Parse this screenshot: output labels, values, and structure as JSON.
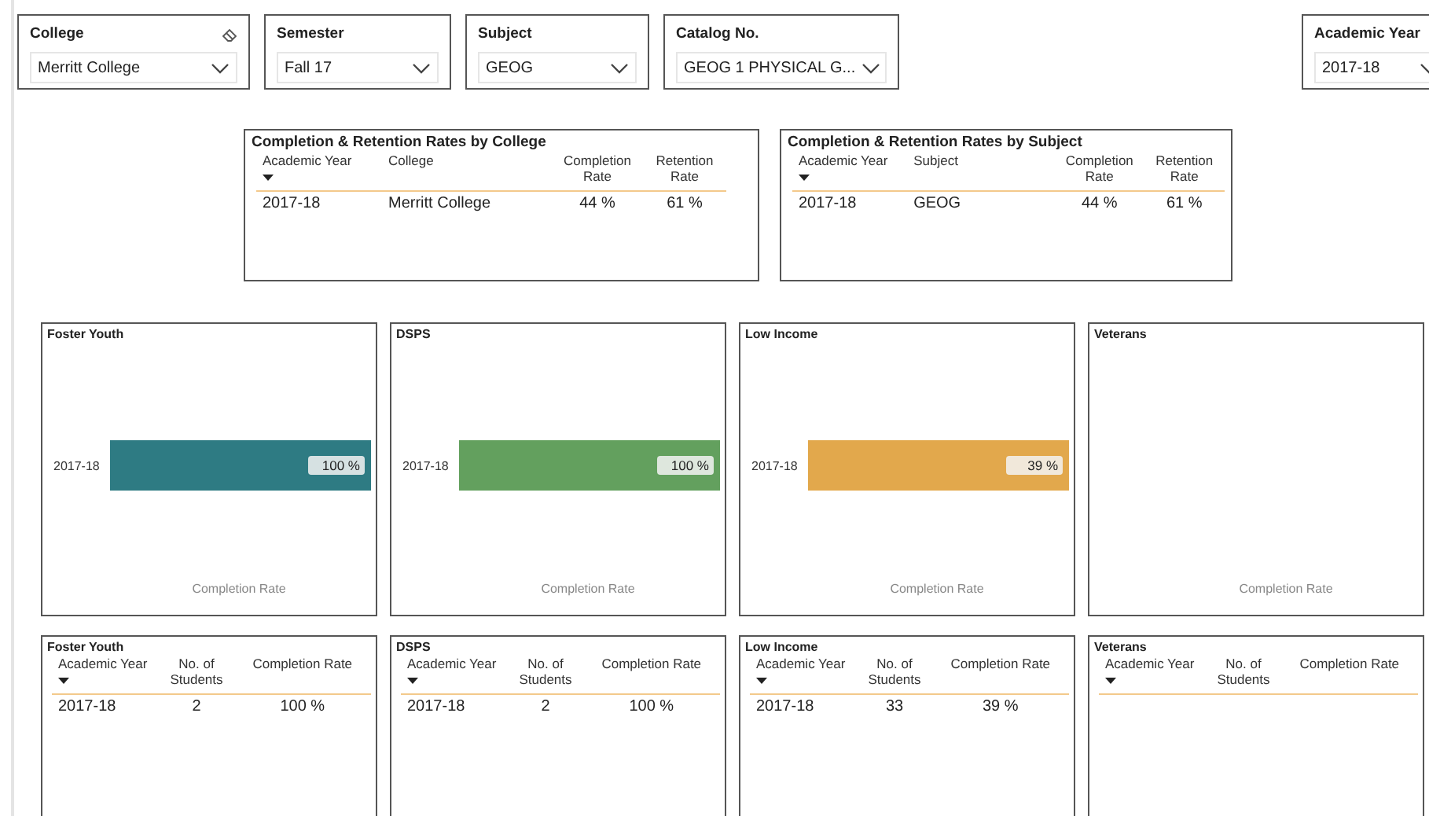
{
  "filters": [
    {
      "label": "College",
      "value": "Merritt College",
      "clearable": true
    },
    {
      "label": "Semester",
      "value": "Fall 17",
      "clearable": false
    },
    {
      "label": "Subject",
      "value": "GEOG",
      "clearable": false
    },
    {
      "label": "Catalog No.",
      "value": "GEOG 1 PHYSICAL G...",
      "clearable": false
    },
    {
      "label": "Academic Year",
      "value": "2017-18"
    }
  ],
  "summary_tables": [
    {
      "title": "Completion & Retention Rates by College",
      "columns": [
        {
          "label": "Academic Year",
          "sorted": true
        },
        {
          "label": "College",
          "sorted": false
        },
        {
          "label": "Completion Rate",
          "sorted": false
        },
        {
          "label": "Retention Rate",
          "sorted": false
        }
      ],
      "rows": [
        [
          "2017-18",
          "Merritt College",
          "44 %",
          "61 %"
        ]
      ]
    },
    {
      "title": "Completion & Retention Rates by Subject",
      "columns": [
        {
          "label": "Academic Year",
          "sorted": true
        },
        {
          "label": "Subject",
          "sorted": false
        },
        {
          "label": "Completion Rate",
          "sorted": false
        },
        {
          "label": "Retention Rate",
          "sorted": false
        }
      ],
      "rows": [
        [
          "2017-18",
          "GEOG",
          "44 %",
          "61 %"
        ]
      ]
    }
  ],
  "group_charts": [
    {
      "title": "Foster Youth",
      "axis_title": "Completion Rate",
      "bars": [
        {
          "category": "2017-18",
          "label": "100 %",
          "level": 1,
          "color": "#2e7b83"
        }
      ]
    },
    {
      "title": "DSPS",
      "axis_title": "Completion Rate",
      "bars": [
        {
          "category": "2017-18",
          "label": "100 %",
          "level": 1,
          "color": "#63a05e"
        }
      ]
    },
    {
      "title": "Low Income",
      "axis_title": "Completion Rate",
      "bars": [
        {
          "category": "2017-18",
          "label": "39 %",
          "level": 1,
          "color": "#e2a84c"
        }
      ]
    },
    {
      "title": "Veterans",
      "axis_title": "Completion Rate"
    }
  ],
  "group_tables": [
    {
      "title": "Foster Youth",
      "columns": [
        {
          "label": "Academic Year",
          "sorted": true
        },
        {
          "label": "No. of Students",
          "sorted": false
        },
        {
          "label": "Completion Rate",
          "sorted": false
        }
      ],
      "rows": [
        [
          "2017-18",
          "2",
          "100 %"
        ]
      ]
    },
    {
      "title": "DSPS",
      "columns": [
        {
          "label": "Academic Year",
          "sorted": true
        },
        {
          "label": "No. of Students",
          "sorted": false
        },
        {
          "label": "Completion Rate",
          "sorted": false
        }
      ],
      "rows": [
        [
          "2017-18",
          "2",
          "100 %"
        ]
      ]
    },
    {
      "title": "Low Income",
      "columns": [
        {
          "label": "Academic Year",
          "sorted": true
        },
        {
          "label": "No. of Students",
          "sorted": false
        },
        {
          "label": "Completion Rate",
          "sorted": false
        }
      ],
      "rows": [
        [
          "2017-18",
          "33",
          "39 %"
        ]
      ]
    },
    {
      "title": "Veterans",
      "columns": [
        {
          "label": "Academic Year",
          "sorted": true
        },
        {
          "label": "No. of Students",
          "sorted": false
        },
        {
          "label": "Completion Rate",
          "sorted": false
        }
      ]
    }
  ]
}
